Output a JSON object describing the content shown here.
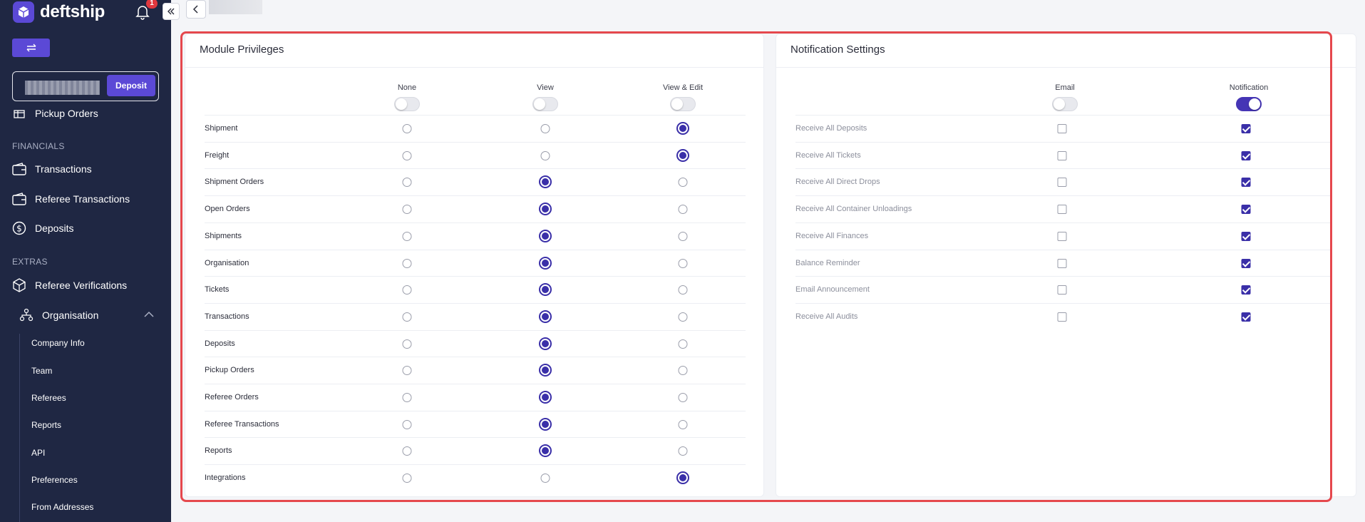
{
  "brand": {
    "name": "deftship",
    "notification_count": "1"
  },
  "sidebar": {
    "deposit_label": "Deposit",
    "partial_item": "Pickup Orders",
    "sections": {
      "financials": "FINANCIALS",
      "extras": "EXTRAS"
    },
    "financial_items": [
      "Transactions",
      "Referee Transactions",
      "Deposits"
    ],
    "extras_items": [
      "Referee Verifications",
      "Organisation"
    ],
    "organisation_subitems": [
      "Company Info",
      "Team",
      "Referees",
      "Reports",
      "API",
      "Preferences",
      "From Addresses"
    ]
  },
  "module_privileges": {
    "title": "Module Privileges",
    "columns": [
      "None",
      "View",
      "View & Edit"
    ],
    "column_toggles": [
      false,
      false,
      false
    ],
    "rows": [
      {
        "label": "Shipment",
        "selected": "View & Edit"
      },
      {
        "label": "Freight",
        "selected": "View & Edit"
      },
      {
        "label": "Shipment Orders",
        "selected": "View"
      },
      {
        "label": "Open Orders",
        "selected": "View"
      },
      {
        "label": "Shipments",
        "selected": "View"
      },
      {
        "label": "Organisation",
        "selected": "View"
      },
      {
        "label": "Tickets",
        "selected": "View"
      },
      {
        "label": "Transactions",
        "selected": "View"
      },
      {
        "label": "Deposits",
        "selected": "View"
      },
      {
        "label": "Pickup Orders",
        "selected": "View"
      },
      {
        "label": "Referee Orders",
        "selected": "View"
      },
      {
        "label": "Referee Transactions",
        "selected": "View"
      },
      {
        "label": "Reports",
        "selected": "View"
      },
      {
        "label": "Integrations",
        "selected": "View & Edit"
      }
    ]
  },
  "notification_settings": {
    "title": "Notification Settings",
    "columns": [
      "Email",
      "Notification"
    ],
    "column_toggles": [
      false,
      true
    ],
    "rows": [
      {
        "label": "Receive All Deposits",
        "email": false,
        "notification": true
      },
      {
        "label": "Receive All Tickets",
        "email": false,
        "notification": true
      },
      {
        "label": "Receive All Direct Drops",
        "email": false,
        "notification": true
      },
      {
        "label": "Receive All Container Unloadings",
        "email": false,
        "notification": true
      },
      {
        "label": "Receive All Finances",
        "email": false,
        "notification": true
      },
      {
        "label": "Balance Reminder",
        "email": false,
        "notification": true
      },
      {
        "label": "Email Announcement",
        "email": false,
        "notification": true
      },
      {
        "label": "Receive All Audits",
        "email": false,
        "notification": true
      }
    ]
  },
  "colors": {
    "sidebar": "#1f2743",
    "accent": "#5b49d6",
    "selected": "#3a2fa8",
    "highlight": "#e5484d"
  }
}
